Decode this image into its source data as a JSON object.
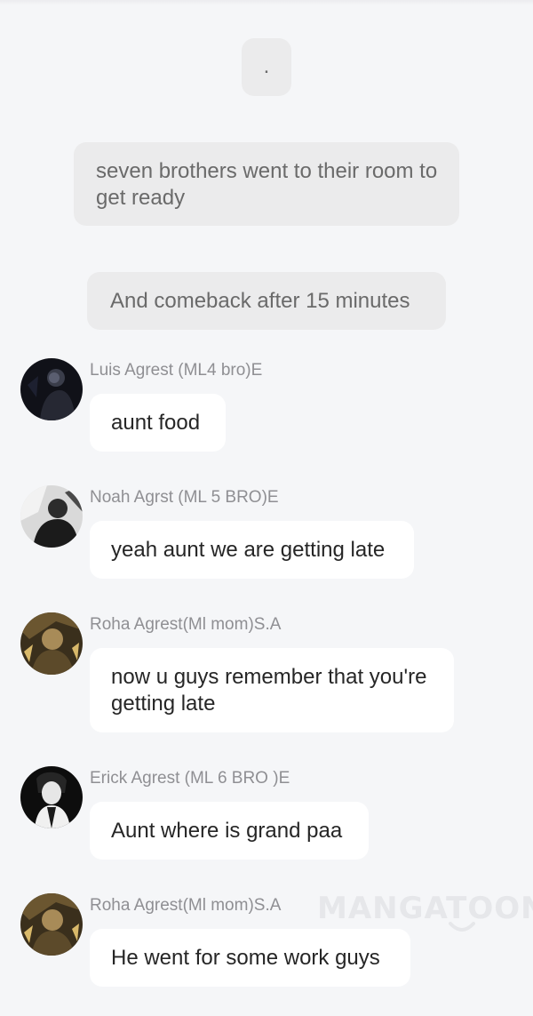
{
  "narrations": [
    {
      "text": "."
    },
    {
      "text": "seven brothers went to their room to get ready"
    },
    {
      "text": "And comeback after 15 minutes"
    }
  ],
  "messages": [
    {
      "sender": "Luis Agrest (ML4 bro)E",
      "text": "aunt food",
      "avatar_icon": "dark-portrait-avatar-icon"
    },
    {
      "sender": "Noah Agrst (ML 5 BRO)E",
      "text": "yeah aunt we are getting late",
      "avatar_icon": "monochrome-portrait-avatar-icon"
    },
    {
      "sender": "Roha Agrest(Ml mom)S.A",
      "text": "now u guys remember that you're getting late",
      "avatar_icon": "golden-portrait-avatar-icon"
    },
    {
      "sender": "Erick Agrest (ML 6 BRO )E",
      "text": "Aunt where is grand paa",
      "avatar_icon": "bw-portrait-avatar-icon"
    },
    {
      "sender": "Roha Agrest(Ml mom)S.A",
      "text": "He went for some work guys",
      "avatar_icon": "golden-portrait-avatar-icon"
    }
  ],
  "watermark": {
    "text": "MANGATOON"
  },
  "colors": {
    "background": "#f5f6f8",
    "narration_bubble": "#ebebec",
    "message_bubble": "#ffffff",
    "sender_text": "#8f8f93",
    "message_text": "#262626"
  }
}
